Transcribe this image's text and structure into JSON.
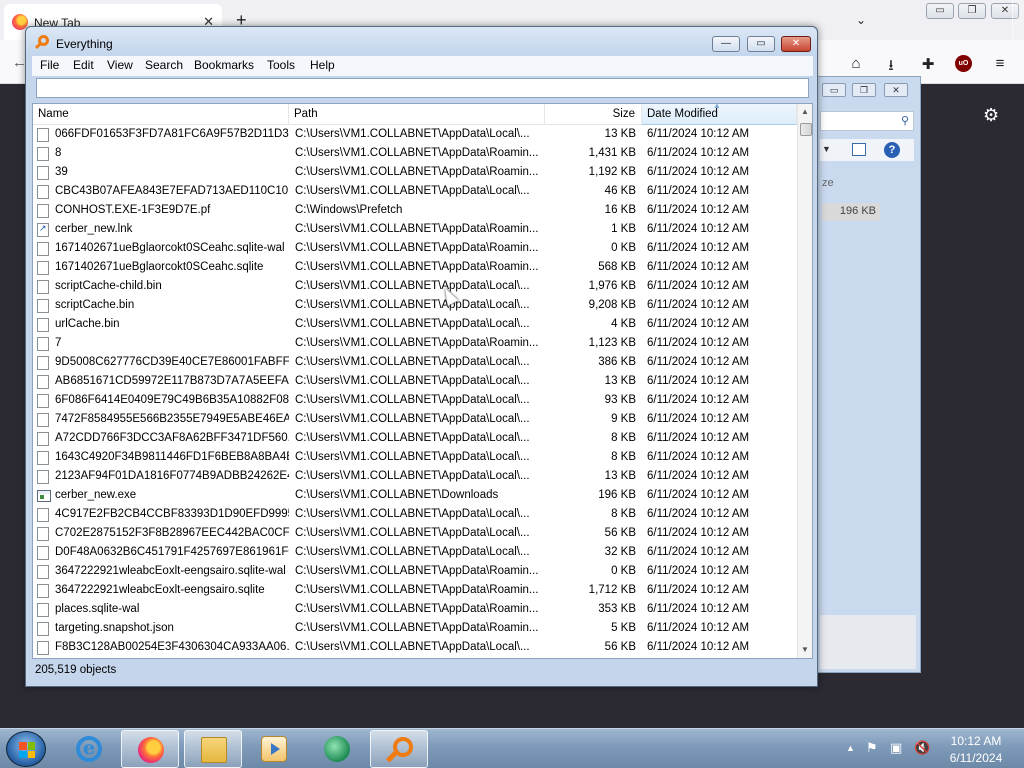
{
  "browser": {
    "tab_title": "New Tab",
    "tab_close": "✕",
    "new_tab": "+",
    "list_tabs": "⌄",
    "caption": {
      "minimize": "▭",
      "maximize": "❐",
      "close": "✕"
    },
    "toolbar_icons": {
      "back": "←",
      "pocket": "⌂",
      "downloads": "⭳",
      "extensions": "✚",
      "ublock": "uO",
      "menu": "≡"
    },
    "settings_icon": "⚙"
  },
  "bg_window": {
    "column_fragment": "ze",
    "size_value": "196 KB",
    "help": "?"
  },
  "everything": {
    "title": "Everything",
    "caption": {
      "minimize": "—",
      "maximize": "▭",
      "close": "✕"
    },
    "menu": [
      "File",
      "Edit",
      "View",
      "Search",
      "Bookmarks",
      "Tools",
      "Help"
    ],
    "search": {
      "value": "",
      "placeholder": ""
    },
    "columns": {
      "name": "Name",
      "path": "Path",
      "size": "Size",
      "date": "Date Modified"
    },
    "sort": {
      "column": "date",
      "arrow": "▲"
    },
    "rows": [
      {
        "icon": "file",
        "name": "066FDF01653F3FD7A81FC6A9F57B2D11D3...",
        "path": "C:\\Users\\VM1.COLLABNET\\AppData\\Local\\...",
        "size": "13 KB",
        "date": "6/11/2024 10:12 AM"
      },
      {
        "icon": "file",
        "name": "8",
        "path": "C:\\Users\\VM1.COLLABNET\\AppData\\Roamin...",
        "size": "1,431 KB",
        "date": "6/11/2024 10:12 AM"
      },
      {
        "icon": "file",
        "name": "39",
        "path": "C:\\Users\\VM1.COLLABNET\\AppData\\Roamin...",
        "size": "1,192 KB",
        "date": "6/11/2024 10:12 AM"
      },
      {
        "icon": "file",
        "name": "CBC43B07AFEA843E7EFAD713AED110C10...",
        "path": "C:\\Users\\VM1.COLLABNET\\AppData\\Local\\...",
        "size": "46 KB",
        "date": "6/11/2024 10:12 AM"
      },
      {
        "icon": "file",
        "name": "CONHOST.EXE-1F3E9D7E.pf",
        "path": "C:\\Windows\\Prefetch",
        "size": "16 KB",
        "date": "6/11/2024 10:12 AM"
      },
      {
        "icon": "lnk",
        "name": "cerber_new.lnk",
        "path": "C:\\Users\\VM1.COLLABNET\\AppData\\Roamin...",
        "size": "1 KB",
        "date": "6/11/2024 10:12 AM"
      },
      {
        "icon": "file",
        "name": "1671402671ueBglaorcokt0SCeahc.sqlite-wal",
        "path": "C:\\Users\\VM1.COLLABNET\\AppData\\Roamin...",
        "size": "0 KB",
        "date": "6/11/2024 10:12 AM"
      },
      {
        "icon": "file",
        "name": "1671402671ueBglaorcokt0SCeahc.sqlite",
        "path": "C:\\Users\\VM1.COLLABNET\\AppData\\Roamin...",
        "size": "568 KB",
        "date": "6/11/2024 10:12 AM"
      },
      {
        "icon": "file",
        "name": "scriptCache-child.bin",
        "path": "C:\\Users\\VM1.COLLABNET\\AppData\\Local\\...",
        "size": "1,976 KB",
        "date": "6/11/2024 10:12 AM"
      },
      {
        "icon": "file",
        "name": "scriptCache.bin",
        "path": "C:\\Users\\VM1.COLLABNET\\AppData\\Local\\...",
        "size": "9,208 KB",
        "date": "6/11/2024 10:12 AM"
      },
      {
        "icon": "file",
        "name": "urlCache.bin",
        "path": "C:\\Users\\VM1.COLLABNET\\AppData\\Local\\...",
        "size": "4 KB",
        "date": "6/11/2024 10:12 AM"
      },
      {
        "icon": "file",
        "name": "7",
        "path": "C:\\Users\\VM1.COLLABNET\\AppData\\Roamin...",
        "size": "1,123 KB",
        "date": "6/11/2024 10:12 AM"
      },
      {
        "icon": "file",
        "name": "9D5008C627776CD39E40CE7E86001FABFF...",
        "path": "C:\\Users\\VM1.COLLABNET\\AppData\\Local\\...",
        "size": "386 KB",
        "date": "6/11/2024 10:12 AM"
      },
      {
        "icon": "file",
        "name": "AB6851671CD59972E117B873D7A7A5EEFA...",
        "path": "C:\\Users\\VM1.COLLABNET\\AppData\\Local\\...",
        "size": "13 KB",
        "date": "6/11/2024 10:12 AM"
      },
      {
        "icon": "file",
        "name": "6F086F6414E0409E79C49B6B35A10882F08E...",
        "path": "C:\\Users\\VM1.COLLABNET\\AppData\\Local\\...",
        "size": "93 KB",
        "date": "6/11/2024 10:12 AM"
      },
      {
        "icon": "file",
        "name": "7472F8584955E566B2355E7949E5ABE46EA...",
        "path": "C:\\Users\\VM1.COLLABNET\\AppData\\Local\\...",
        "size": "9 KB",
        "date": "6/11/2024 10:12 AM"
      },
      {
        "icon": "file",
        "name": "A72CDD766F3DCC3AF8A62BFF3471DF560...",
        "path": "C:\\Users\\VM1.COLLABNET\\AppData\\Local\\...",
        "size": "8 KB",
        "date": "6/11/2024 10:12 AM"
      },
      {
        "icon": "file",
        "name": "1643C4920F34B9811446FD1F6BEB8A8BA4B...",
        "path": "C:\\Users\\VM1.COLLABNET\\AppData\\Local\\...",
        "size": "8 KB",
        "date": "6/11/2024 10:12 AM"
      },
      {
        "icon": "file",
        "name": "2123AF94F01DA1816F0774B9ADBB24262E4...",
        "path": "C:\\Users\\VM1.COLLABNET\\AppData\\Local\\...",
        "size": "13 KB",
        "date": "6/11/2024 10:12 AM"
      },
      {
        "icon": "exe",
        "name": "cerber_new.exe",
        "path": "C:\\Users\\VM1.COLLABNET\\Downloads",
        "size": "196 KB",
        "date": "6/11/2024 10:12 AM"
      },
      {
        "icon": "file",
        "name": "4C917E2FB2CB4CCBF83393D1D90EFD9995...",
        "path": "C:\\Users\\VM1.COLLABNET\\AppData\\Local\\...",
        "size": "8 KB",
        "date": "6/11/2024 10:12 AM"
      },
      {
        "icon": "file",
        "name": "C702E2875152F3F8B28967EEC442BAC0CFF...",
        "path": "C:\\Users\\VM1.COLLABNET\\AppData\\Local\\...",
        "size": "56 KB",
        "date": "6/11/2024 10:12 AM"
      },
      {
        "icon": "file",
        "name": "D0F48A0632B6C451791F4257697E861961F0...",
        "path": "C:\\Users\\VM1.COLLABNET\\AppData\\Local\\...",
        "size": "32 KB",
        "date": "6/11/2024 10:12 AM"
      },
      {
        "icon": "file",
        "name": "3647222921wleabcEoxlt-eengsairo.sqlite-wal",
        "path": "C:\\Users\\VM1.COLLABNET\\AppData\\Roamin...",
        "size": "0 KB",
        "date": "6/11/2024 10:12 AM"
      },
      {
        "icon": "file",
        "name": "3647222921wleabcEoxlt-eengsairo.sqlite",
        "path": "C:\\Users\\VM1.COLLABNET\\AppData\\Roamin...",
        "size": "1,712 KB",
        "date": "6/11/2024 10:12 AM"
      },
      {
        "icon": "file",
        "name": "places.sqlite-wal",
        "path": "C:\\Users\\VM1.COLLABNET\\AppData\\Roamin...",
        "size": "353 KB",
        "date": "6/11/2024 10:12 AM"
      },
      {
        "icon": "file",
        "name": "targeting.snapshot.json",
        "path": "C:\\Users\\VM1.COLLABNET\\AppData\\Roamin...",
        "size": "5 KB",
        "date": "6/11/2024 10:12 AM"
      },
      {
        "icon": "file",
        "name": "F8B3C128AB00254E3F4306304CA933AA06...",
        "path": "C:\\Users\\VM1.COLLABNET\\AppData\\Local\\...",
        "size": "56 KB",
        "date": "6/11/2024 10:12 AM"
      }
    ],
    "scroll_position": 0.0,
    "status": "205,519 objects"
  },
  "taskbar": {
    "items": [
      {
        "id": "ie",
        "label": "e",
        "active": false
      },
      {
        "id": "firefox",
        "active": true
      },
      {
        "id": "explorer",
        "active": true
      },
      {
        "id": "media",
        "active": false
      },
      {
        "id": "green-app",
        "active": false
      },
      {
        "id": "everything",
        "active": true
      }
    ],
    "tray": {
      "overflow": "▲",
      "flag": "⚑",
      "network": "▣",
      "volume": "🔇"
    },
    "clock": {
      "time": "10:12 AM",
      "date": "6/11/2024"
    }
  }
}
